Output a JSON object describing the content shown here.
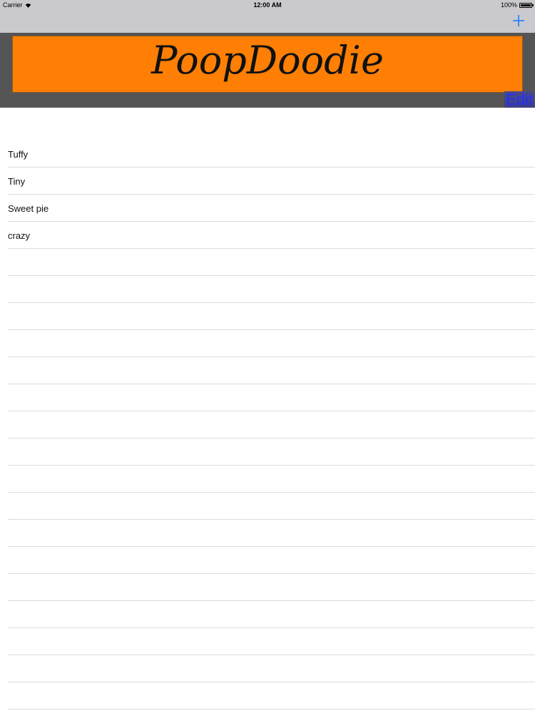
{
  "status_bar": {
    "carrier": "Carrier",
    "time": "12:00 AM",
    "battery": "100%"
  },
  "nav_bar": {
    "add_icon": "plus-icon"
  },
  "header": {
    "title": "PoopDoodie",
    "banner_color": "#ff7f05",
    "edit_label": "Edit"
  },
  "list": {
    "items": [
      "Tuffy",
      "Tiny",
      "Sweet pie",
      "crazy"
    ]
  }
}
